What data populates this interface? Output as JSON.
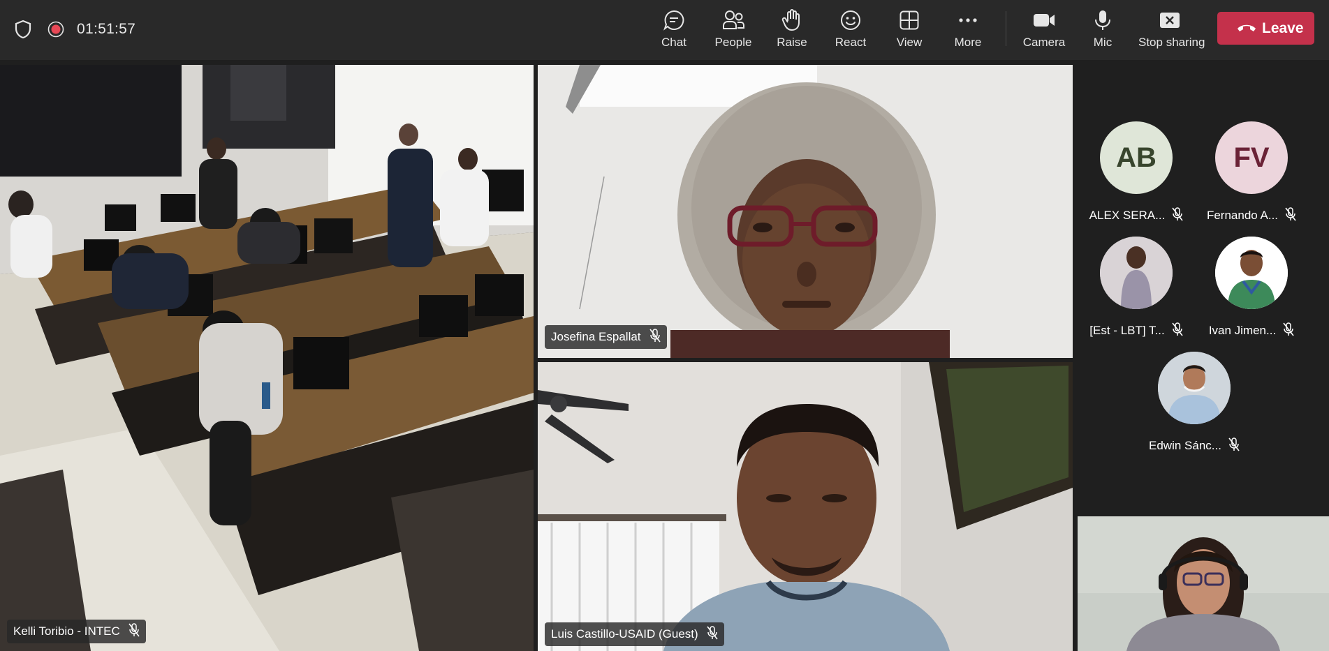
{
  "call": {
    "timer": "01:51:57"
  },
  "toolbar": {
    "chat": "Chat",
    "people": "People",
    "raise": "Raise",
    "react": "React",
    "view": "View",
    "more": "More",
    "camera": "Camera",
    "mic": "Mic",
    "stop_sharing": "Stop sharing",
    "leave": "Leave"
  },
  "videos": [
    {
      "name": "Kelli Toribio - INTEC"
    },
    {
      "name": "Josefina Espallat"
    },
    {
      "name": "Luis Castillo-USAID (Guest)"
    }
  ],
  "roster": [
    {
      "initials": "AB",
      "name": "ALEX SERA...",
      "bg": "#dfe6d8",
      "fg": "#38452d"
    },
    {
      "initials": "FV",
      "name": "Fernando A...",
      "bg": "#ecd5dc",
      "fg": "#6a2236"
    },
    {
      "initials": "",
      "name": "[Est - LBT] T...",
      "bg": "#d9d3d6",
      "fg": "#333333"
    },
    {
      "initials": "",
      "name": "Ivan Jimen...",
      "bg": "#ffffff",
      "fg": "#333333"
    },
    {
      "initials": "",
      "name": "Edwin Sánc...",
      "bg": "#cfd6dc",
      "fg": "#333333"
    }
  ],
  "colors": {
    "leave": "#c4314b",
    "recording": "#e74856",
    "toolbar_bg": "#292929"
  }
}
